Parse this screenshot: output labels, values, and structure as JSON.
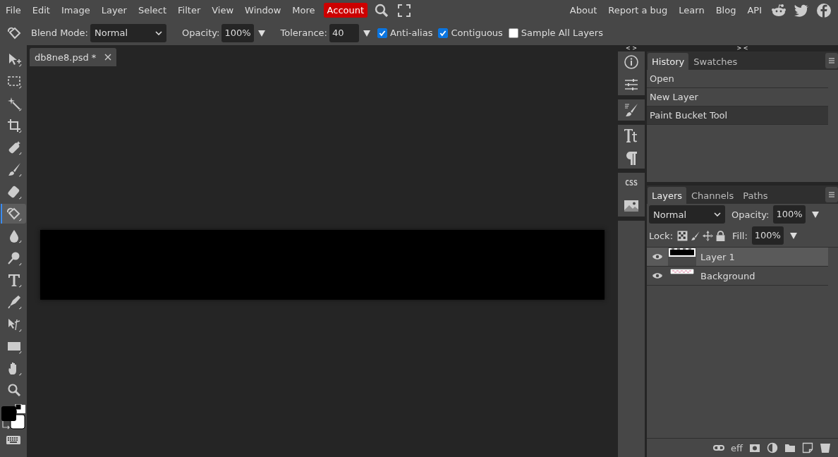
{
  "menu": {
    "items": [
      "File",
      "Edit",
      "Image",
      "Layer",
      "Select",
      "Filter",
      "View",
      "Window",
      "More"
    ],
    "account": "Account",
    "links": [
      "About",
      "Report a bug",
      "Learn",
      "Blog",
      "API"
    ]
  },
  "options": {
    "blend_label": "Blend Mode:",
    "blend_mode": "Normal",
    "opacity_label": "Opacity:",
    "opacity": "100%",
    "tolerance_label": "Tolerance:",
    "tolerance": "40",
    "checkboxes": [
      {
        "label": "Anti-alias",
        "checked": true
      },
      {
        "label": "Contiguous",
        "checked": true
      },
      {
        "label": "Sample All Layers",
        "checked": false
      }
    ]
  },
  "document_tab": {
    "title": "db8ne8.psd *",
    "selected": true
  },
  "tools": [
    {
      "kind": "move",
      "selected": false
    },
    {
      "kind": "marquee",
      "selected": false
    },
    {
      "kind": "wand",
      "selected": false
    },
    {
      "kind": "crop",
      "selected": false
    },
    {
      "kind": "heal",
      "selected": false
    },
    {
      "kind": "brush",
      "selected": false
    },
    {
      "kind": "eraser",
      "selected": false
    },
    {
      "kind": "bucket",
      "selected": true
    },
    {
      "kind": "drop",
      "selected": false
    },
    {
      "kind": "dodge",
      "selected": false
    },
    {
      "kind": "type",
      "selected": false
    },
    {
      "kind": "pen",
      "selected": false
    },
    {
      "kind": "path",
      "selected": false
    },
    {
      "kind": "shape",
      "selected": false
    },
    {
      "kind": "hand",
      "selected": false
    },
    {
      "kind": "zoom",
      "selected": false
    }
  ],
  "side_icons": {
    "expand": "< >",
    "collapse": "> <",
    "css": "CSS"
  },
  "history": {
    "tabs": [
      {
        "label": "History",
        "selected": true
      },
      {
        "label": "Swatches",
        "selected": false
      }
    ],
    "items": [
      {
        "label": "Open",
        "selected": false
      },
      {
        "label": "New Layer",
        "selected": false
      },
      {
        "label": "Paint Bucket Tool",
        "selected": true
      }
    ]
  },
  "layers": {
    "tabs": [
      {
        "label": "Layers",
        "selected": true
      },
      {
        "label": "Channels",
        "selected": false
      },
      {
        "label": "Paths",
        "selected": false
      }
    ],
    "blend_mode": "Normal",
    "opacity_label": "Opacity:",
    "opacity": "100%",
    "lock_label": "Lock:",
    "fill_label": "Fill:",
    "fill": "100%",
    "items": [
      {
        "name": "Layer 1",
        "selected": true,
        "visible": true,
        "kind": "black"
      },
      {
        "name": "Background",
        "selected": false,
        "visible": true,
        "kind": "transparent"
      }
    ],
    "effects_label": "eff"
  }
}
